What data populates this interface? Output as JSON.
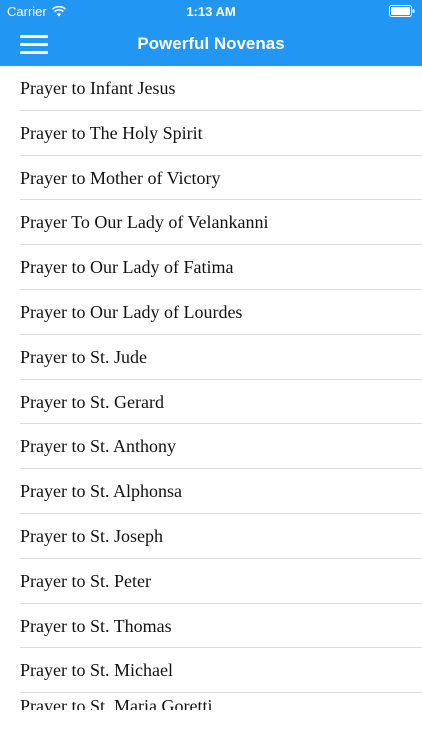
{
  "status_bar": {
    "carrier": "Carrier",
    "time": "1:13 AM",
    "wifi_icon": "wifi-icon",
    "battery_icon": "battery-icon"
  },
  "nav_bar": {
    "title": "Powerful Novenas",
    "menu_icon": "hamburger-menu-icon",
    "color": "#2196f3"
  },
  "list": {
    "items": [
      {
        "label": "Prayer to Infant Jesus"
      },
      {
        "label": "Prayer to The Holy Spirit"
      },
      {
        "label": "Prayer to Mother of Victory"
      },
      {
        "label": "Prayer To Our Lady of Velankanni"
      },
      {
        "label": "Prayer to Our Lady of Fatima"
      },
      {
        "label": "Prayer to Our Lady of Lourdes"
      },
      {
        "label": "Prayer to St. Jude"
      },
      {
        "label": "Prayer to St. Gerard"
      },
      {
        "label": "Prayer to St. Anthony"
      },
      {
        "label": "Prayer to St. Alphonsa"
      },
      {
        "label": "Prayer to St. Joseph"
      },
      {
        "label": "Prayer to St. Peter"
      },
      {
        "label": "Prayer to St. Thomas"
      },
      {
        "label": "Prayer to St. Michael"
      },
      {
        "label": "Prayer to St. Maria Goretti"
      }
    ]
  }
}
